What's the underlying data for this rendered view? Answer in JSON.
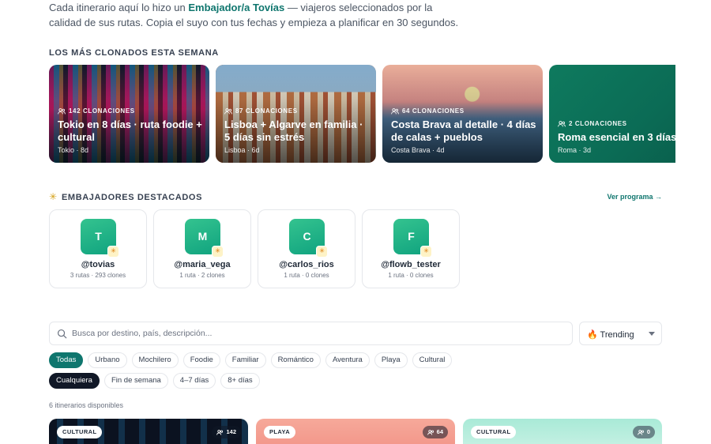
{
  "intro": {
    "line1_prefix": "Cada itinerario aquí lo hizo un ",
    "ambassador_link": "Embajador/a Tovías",
    "line1_suffix": " — viajeros seleccionados por la",
    "line2": "calidad de sus rutas. Copia el suyo con tus fechas y empieza a planificar en 30 segundos."
  },
  "top_cloned": {
    "title": "LOS MÁS CLONADOS ESTA SEMANA",
    "cards": [
      {
        "clones": "142 CLONACIONES",
        "title": "Tokio en 8 días · ruta foodie + cultural",
        "sub": "Tokio · 8d"
      },
      {
        "clones": "87 CLONACIONES",
        "title": "Lisboa + Algarve en familia · 5 días sin estrés",
        "sub": "Lisboa · 6d"
      },
      {
        "clones": "64 CLONACIONES",
        "title": "Costa Brava al detalle · 4 días de calas + pueblos",
        "sub": "Costa Brava · 4d"
      },
      {
        "clones": "2 CLONACIONES",
        "title": "Roma esencial en 3 días",
        "sub": "Roma · 3d"
      }
    ]
  },
  "ambassadors": {
    "title": "EMBAJADORES DESTACADOS",
    "link": "Ver programa →",
    "items": [
      {
        "initial": "T",
        "handle": "@tovias",
        "stats": "3 rutas · 293 clones"
      },
      {
        "initial": "M",
        "handle": "@maria_vega",
        "stats": "1 ruta · 2 clones"
      },
      {
        "initial": "C",
        "handle": "@carlos_rios",
        "stats": "1 ruta · 0 clones"
      },
      {
        "initial": "F",
        "handle": "@flowb_tester",
        "stats": "1 ruta · 0 clones"
      }
    ]
  },
  "search": {
    "placeholder": "Busca por destino, país, descripción...",
    "value": ""
  },
  "sort": {
    "selected": "🔥 Trending"
  },
  "category_chips": [
    "Todas",
    "Urbano",
    "Mochilero",
    "Foodie",
    "Familiar",
    "Romántico",
    "Aventura",
    "Playa",
    "Cultural"
  ],
  "duration_chips": [
    "Cualquiera",
    "Fin de semana",
    "4–7 días",
    "8+ días"
  ],
  "results_count": "6 itinerarios disponibles",
  "results": [
    {
      "tag": "CULTURAL",
      "count": "142"
    },
    {
      "tag": "PLAYA",
      "count": "64"
    },
    {
      "tag": "CULTURAL",
      "count": "0"
    }
  ],
  "colors": {
    "accent": "#0f766e",
    "dark": "#111827",
    "avatar": "#10a37f"
  }
}
